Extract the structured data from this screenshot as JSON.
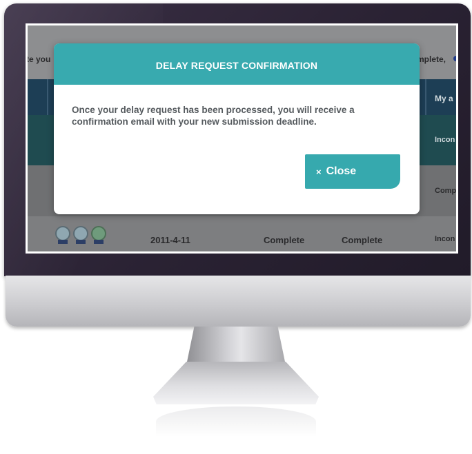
{
  "modal": {
    "title": "DELAY REQUEST CONFIRMATION",
    "message": "Once your delay request has been processed, you will receive a confirmation email with your new submission deadline.",
    "close_icon": "×",
    "close_label": "Close"
  },
  "background": {
    "left_fragment": "te you",
    "right_fragment": "mplete,",
    "header_col_right": "My a",
    "row1_right": "Incon",
    "row2_right": "Comp",
    "row3": {
      "date": "2011-4-11",
      "status1": "Complete",
      "status2": "Complete",
      "status3": "Incon"
    },
    "badges": [
      "badge-1",
      "badge-2",
      "badge-3"
    ]
  },
  "colors": {
    "accent": "#36a9ae",
    "frame": "#2a2233",
    "overlay": "#7f8082"
  }
}
